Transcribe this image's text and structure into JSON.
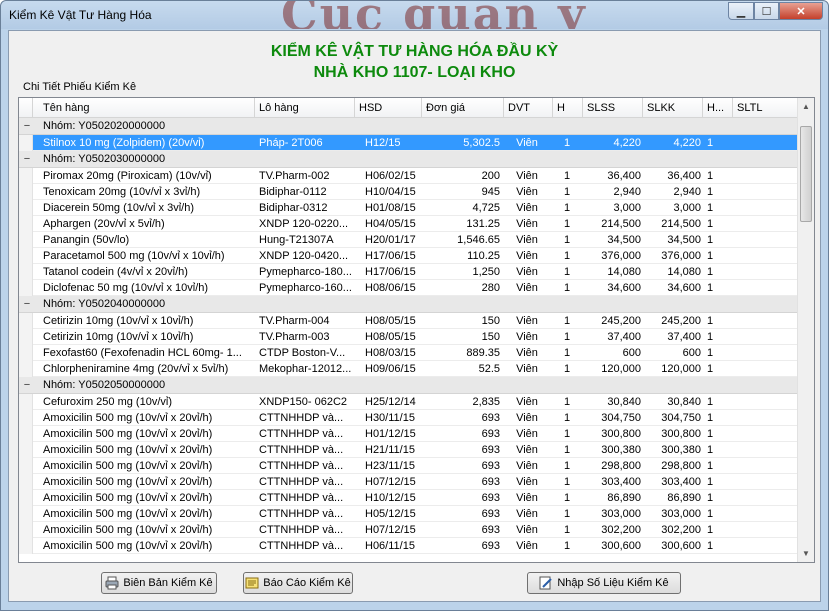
{
  "window": {
    "title": "Kiểm Kê Vật Tư Hàng Hóa",
    "watermark": "Cuc quan y"
  },
  "header": {
    "line1": "KIỂM KÊ VẬT TƯ HÀNG HÓA ĐẦU KỲ",
    "line2": "NHÀ KHO 1107- LOẠI KHO"
  },
  "panel_label": "Chi Tiết Phiếu Kiểm Kê",
  "columns": [
    "Tên hàng",
    "Lô hàng",
    "HSD",
    "Đơn giá",
    "DVT",
    "H",
    "SLSS",
    "SLKK",
    "H...",
    "SLTL"
  ],
  "groups": [
    {
      "label": "Nhóm:  Y0502020000000",
      "toggle": "−",
      "rows": [
        {
          "name": "Stilnox 10 mg (Zolpidem) (20v/vỉ)",
          "lot": "Pháp- 2T006",
          "hsd": "H12/15",
          "price": "5,302.5",
          "unit": "Viên",
          "h": "1",
          "slss": "4,220",
          "slkk": "4,220",
          "h2": "1",
          "sltl": "",
          "selected": true
        }
      ]
    },
    {
      "label": "Nhóm:  Y0502030000000",
      "toggle": "−",
      "rows": [
        {
          "name": "Piromax 20mg (Piroxicam) (10v/vỉ)",
          "lot": "TV.Pharm-002",
          "hsd": "H06/02/15",
          "price": "200",
          "unit": "Viên",
          "h": "1",
          "slss": "36,400",
          "slkk": "36,400",
          "h2": "1",
          "sltl": ""
        },
        {
          "name": "Tenoxicam 20mg (10v/vỉ x 3vỉ/h)",
          "lot": "Bidiphar-0112",
          "hsd": "H10/04/15",
          "price": "945",
          "unit": "Viên",
          "h": "1",
          "slss": "2,940",
          "slkk": "2,940",
          "h2": "1",
          "sltl": ""
        },
        {
          "name": "Diacerein 50mg (10v/vỉ x 3vỉ/h)",
          "lot": "Bidiphar-0312",
          "hsd": "H01/08/15",
          "price": "4,725",
          "unit": "Viên",
          "h": "1",
          "slss": "3,000",
          "slkk": "3,000",
          "h2": "1",
          "sltl": ""
        },
        {
          "name": "Aphargen (20v/vỉ x 5vỉ/h)",
          "lot": "XNDP  120-0220...",
          "hsd": "H04/05/15",
          "price": "131.25",
          "unit": "Viên",
          "h": "1",
          "slss": "214,500",
          "slkk": "214,500",
          "h2": "1",
          "sltl": ""
        },
        {
          "name": "Panangin (50v/lo)",
          "lot": "Hung-T21307A",
          "hsd": "H20/01/17",
          "price": "1,546.65",
          "unit": "Viên",
          "h": "1",
          "slss": "34,500",
          "slkk": "34,500",
          "h2": "1",
          "sltl": ""
        },
        {
          "name": "Paracetamol 500 mg (10v/vỉ x 10vỉ/h)",
          "lot": "XNDP  120-0420...",
          "hsd": "H17/06/15",
          "price": "110.25",
          "unit": "Viên",
          "h": "1",
          "slss": "376,000",
          "slkk": "376,000",
          "h2": "1",
          "sltl": ""
        },
        {
          "name": "Tatanol codein (4v/vỉ x 20vỉ/h)",
          "lot": "Pymepharco-180...",
          "hsd": "H17/06/15",
          "price": "1,250",
          "unit": "Viên",
          "h": "1",
          "slss": "14,080",
          "slkk": "14,080",
          "h2": "1",
          "sltl": ""
        },
        {
          "name": "Diclofenac 50 mg (10v/vỉ x 10vỉ/h)",
          "lot": "Pymepharco-160...",
          "hsd": "H08/06/15",
          "price": "280",
          "unit": "Viên",
          "h": "1",
          "slss": "34,600",
          "slkk": "34,600",
          "h2": "1",
          "sltl": ""
        }
      ]
    },
    {
      "label": "Nhóm:  Y0502040000000",
      "toggle": "−",
      "rows": [
        {
          "name": "Cetirizin 10mg (10v/vỉ x 10vỉ/h)",
          "lot": "TV.Pharm-004",
          "hsd": "H08/05/15",
          "price": "150",
          "unit": "Viên",
          "h": "1",
          "slss": "245,200",
          "slkk": "245,200",
          "h2": "1",
          "sltl": ""
        },
        {
          "name": "Cetirizin 10mg (10v/vỉ x 10vỉ/h)",
          "lot": "TV.Pharm-003",
          "hsd": "H08/05/15",
          "price": "150",
          "unit": "Viên",
          "h": "1",
          "slss": "37,400",
          "slkk": "37,400",
          "h2": "1",
          "sltl": ""
        },
        {
          "name": "Fexofast60 (Fexofenadin HCL 60mg- 1...",
          "lot": "CTDP  Boston-V...",
          "hsd": "H08/03/15",
          "price": "889.35",
          "unit": "Viên",
          "h": "1",
          "slss": "600",
          "slkk": "600",
          "h2": "1",
          "sltl": ""
        },
        {
          "name": "Chlorpheniramine 4mg (20v/vỉ x 5vỉ/h)",
          "lot": "Mekophar-12012...",
          "hsd": "H09/06/15",
          "price": "52.5",
          "unit": "Viên",
          "h": "1",
          "slss": "120,000",
          "slkk": "120,000",
          "h2": "1",
          "sltl": ""
        }
      ]
    },
    {
      "label": "Nhóm:  Y0502050000000",
      "toggle": "−",
      "rows": [
        {
          "name": "Cefuroxim 250 mg (10v/vỉ)",
          "lot": "XNDP150- 062C2",
          "hsd": "H25/12/14",
          "price": "2,835",
          "unit": "Viên",
          "h": "1",
          "slss": "30,840",
          "slkk": "30,840",
          "h2": "1",
          "sltl": ""
        },
        {
          "name": "Amoxicilin 500 mg (10v/vỉ x 20vỉ/h)",
          "lot": "CTTNHHDP và...",
          "hsd": "H30/11/15",
          "price": "693",
          "unit": "Viên",
          "h": "1",
          "slss": "304,750",
          "slkk": "304,750",
          "h2": "1",
          "sltl": ""
        },
        {
          "name": "Amoxicilin 500 mg (10v/vỉ x 20vỉ/h)",
          "lot": "CTTNHHDP và...",
          "hsd": "H01/12/15",
          "price": "693",
          "unit": "Viên",
          "h": "1",
          "slss": "300,800",
          "slkk": "300,800",
          "h2": "1",
          "sltl": ""
        },
        {
          "name": "Amoxicilin 500 mg (10v/vỉ x 20vỉ/h)",
          "lot": "CTTNHHDP và...",
          "hsd": "H21/11/15",
          "price": "693",
          "unit": "Viên",
          "h": "1",
          "slss": "300,380",
          "slkk": "300,380",
          "h2": "1",
          "sltl": ""
        },
        {
          "name": "Amoxicilin 500 mg (10v/vỉ x 20vỉ/h)",
          "lot": "CTTNHHDP và...",
          "hsd": "H23/11/15",
          "price": "693",
          "unit": "Viên",
          "h": "1",
          "slss": "298,800",
          "slkk": "298,800",
          "h2": "1",
          "sltl": ""
        },
        {
          "name": "Amoxicilin 500 mg (10v/vỉ x 20vỉ/h)",
          "lot": "CTTNHHDP và...",
          "hsd": "H07/12/15",
          "price": "693",
          "unit": "Viên",
          "h": "1",
          "slss": "303,400",
          "slkk": "303,400",
          "h2": "1",
          "sltl": ""
        },
        {
          "name": "Amoxicilin 500 mg (10v/vỉ x 20vỉ/h)",
          "lot": "CTTNHHDP và...",
          "hsd": "H10/12/15",
          "price": "693",
          "unit": "Viên",
          "h": "1",
          "slss": "86,890",
          "slkk": "86,890",
          "h2": "1",
          "sltl": ""
        },
        {
          "name": "Amoxicilin 500 mg (10v/vỉ x 20vỉ/h)",
          "lot": "CTTNHHDP và...",
          "hsd": "H05/12/15",
          "price": "693",
          "unit": "Viên",
          "h": "1",
          "slss": "303,000",
          "slkk": "303,000",
          "h2": "1",
          "sltl": ""
        },
        {
          "name": "Amoxicilin 500 mg (10v/vỉ x 20vỉ/h)",
          "lot": "CTTNHHDP và...",
          "hsd": "H07/12/15",
          "price": "693",
          "unit": "Viên",
          "h": "1",
          "slss": "302,200",
          "slkk": "302,200",
          "h2": "1",
          "sltl": ""
        },
        {
          "name": "Amoxicilin 500 mg (10v/vỉ x 20vỉ/h)",
          "lot": "CTTNHHDP và...",
          "hsd": "H06/11/15",
          "price": "693",
          "unit": "Viên",
          "h": "1",
          "slss": "300,600",
          "slkk": "300,600",
          "h2": "1",
          "sltl": ""
        }
      ]
    }
  ],
  "buttons": {
    "report": "Biên Bản Kiểm Kê",
    "summary": "Báo Cáo Kiểm Kê",
    "import": "Nhập Số Liệu Kiểm Kê"
  },
  "colors": {
    "header_green": "#0d8a0d",
    "selection": "#3399ff"
  }
}
